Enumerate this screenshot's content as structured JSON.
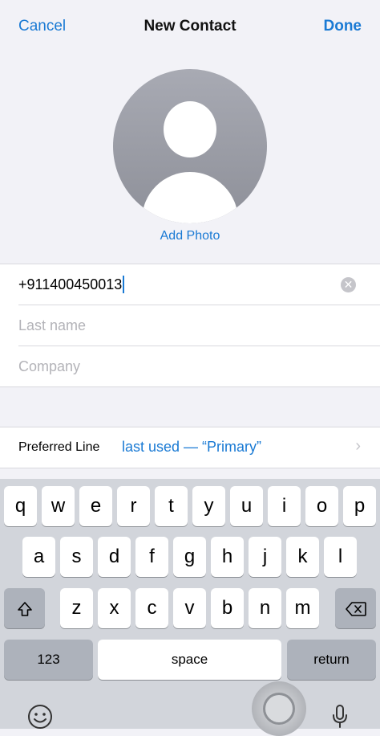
{
  "nav": {
    "cancel_label": "Cancel",
    "title": "New Contact",
    "done_label": "Done"
  },
  "photo": {
    "add_label": "Add Photo"
  },
  "fields": {
    "first_value": "+911400450013",
    "last_placeholder": "Last name",
    "company_placeholder": "Company",
    "clear_symbol": "✕"
  },
  "preferred_line": {
    "label": "Preferred Line",
    "value": "last used — “Primary”",
    "chevron": "›"
  },
  "keyboard": {
    "row1": [
      "q",
      "w",
      "e",
      "r",
      "t",
      "y",
      "u",
      "i",
      "o",
      "p"
    ],
    "row2": [
      "a",
      "s",
      "d",
      "f",
      "g",
      "h",
      "j",
      "k",
      "l"
    ],
    "row3": [
      "z",
      "x",
      "c",
      "v",
      "b",
      "n",
      "m"
    ],
    "numbers_label": "123",
    "space_label": "space",
    "return_label": "return"
  },
  "colors": {
    "accent": "#1a7ad4",
    "background": "#f2f2f7",
    "keyboard_bg": "#d2d5db"
  },
  "icons": {
    "shift": "shift-icon",
    "delete": "backspace-icon",
    "emoji": "emoji-icon",
    "mic": "microphone-icon"
  }
}
